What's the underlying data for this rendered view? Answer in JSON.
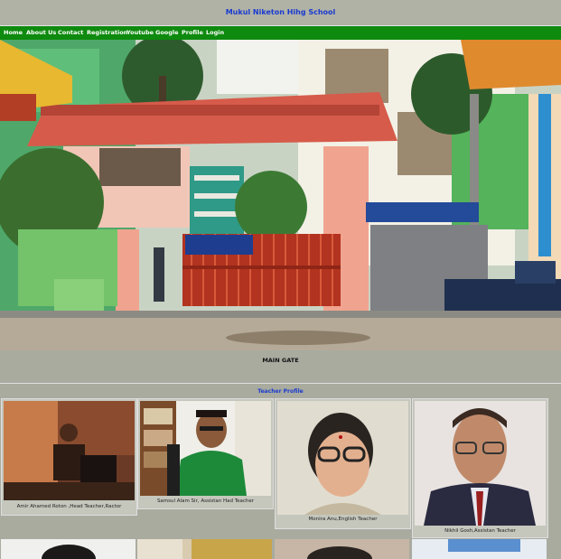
{
  "site": {
    "title": "Mukul Niketon Hihg School"
  },
  "nav": {
    "items": [
      "Home",
      "About Us",
      "Contact",
      "Registration",
      "Youtube",
      "Google",
      "Profile",
      "Login"
    ]
  },
  "hero": {
    "caption": "MAIN GATE"
  },
  "teachers": {
    "heading": "Teacher Profile",
    "cards": [
      {
        "name": "Amir Ahamed Roton ,Head Teacher,Ractor"
      },
      {
        "name": "Samsul Alam Sir, Assistan Had Teacher"
      },
      {
        "name": "Monira Anu,English Teacher"
      },
      {
        "name": "Nikhil Gosh,Assistan Teacher"
      }
    ]
  },
  "colors": {
    "nav": "#0e8a0e",
    "title": "#1a3bcf",
    "background": "#a9ab9f"
  }
}
